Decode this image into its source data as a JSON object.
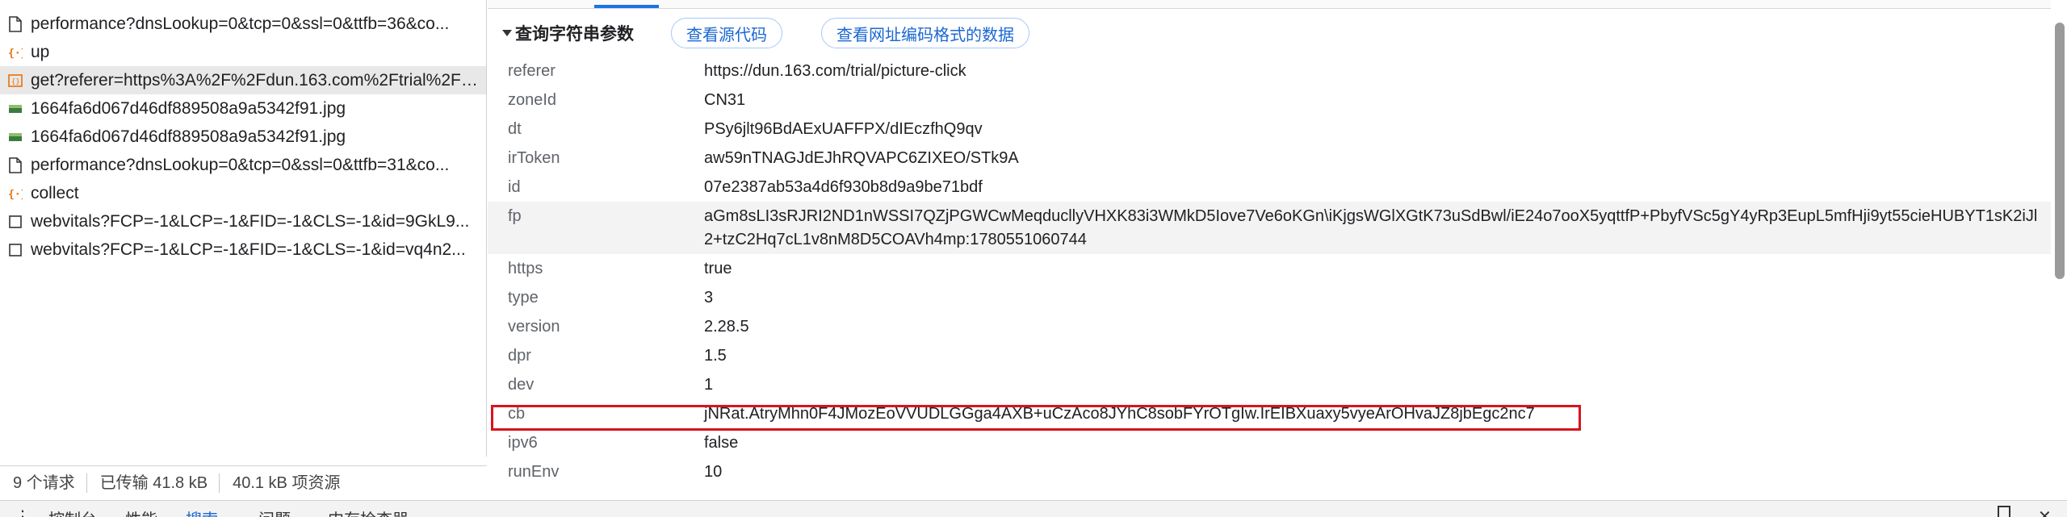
{
  "requests": [
    {
      "icon": "doc",
      "name": "performance?dnsLookup=0&tcp=0&ssl=0&ttfb=36&co..."
    },
    {
      "icon": "script",
      "name": "up"
    },
    {
      "icon": "api",
      "name": "get?referer=https%3A%2F%2Fdun.163.com%2Ftrial%2Fp...",
      "selected": true
    },
    {
      "icon": "image",
      "name": "1664fa6d067d46df889508a9a5342f91.jpg"
    },
    {
      "icon": "image",
      "name": "1664fa6d067d46df889508a9a5342f91.jpg"
    },
    {
      "icon": "doc",
      "name": "performance?dnsLookup=0&tcp=0&ssl=0&ttfb=31&co..."
    },
    {
      "icon": "script",
      "name": "collect"
    },
    {
      "icon": "checkbox",
      "name": "webvitals?FCP=-1&LCP=-1&FID=-1&CLS=-1&id=9GkL9..."
    },
    {
      "icon": "checkbox",
      "name": "webvitals?FCP=-1&LCP=-1&FID=-1&CLS=-1&id=vq4n2..."
    }
  ],
  "status_bar": {
    "requests": "9 个请求",
    "transferred": "已传输 41.8 kB",
    "resources": "40.1 kB 项资源"
  },
  "section": {
    "title": "查询字符串参数",
    "view_source": "查看源代码",
    "view_url_encoded": "查看网址编码格式的数据"
  },
  "params": [
    {
      "key": "referer",
      "value": "https://dun.163.com/trial/picture-click"
    },
    {
      "key": "zoneId",
      "value": "CN31"
    },
    {
      "key": "dt",
      "value": "PSy6jlt96BdAExUAFFPX/dIEczfhQ9qv"
    },
    {
      "key": "irToken",
      "value": "aw59nTNAGJdEJhRQVAPC6ZIXEO/STk9A"
    },
    {
      "key": "id",
      "value": "07e2387ab53a4d6f930b8d9a9be71bdf"
    },
    {
      "key": "fp",
      "value": "aGm8sLI3sRJRI2ND1nWSSI7QZjPGWCwMeqducllyVHXK83i3WMkD5Iove7Ve6oKGn\\iKjgsWGlXGtK73uSdBwl/iE24o7ooX5yqttfP+PbyfVSc5gY4yRp3EupL5mfHji9yt55cieHUBYT1sK2iJl2+tzC2Hq7cL1v8nM8D5COAVh4mp:1780551060744"
    },
    {
      "key": "https",
      "value": "true"
    },
    {
      "key": "type",
      "value": "3"
    },
    {
      "key": "version",
      "value": "2.28.5"
    },
    {
      "key": "dpr",
      "value": "1.5"
    },
    {
      "key": "dev",
      "value": "1"
    },
    {
      "key": "cb",
      "value": "jNRat.AtryMhn0F4JMozEoVVUDLGGga4AXB+uCzAco8JYhC8sobFYrOTgIw.IrEIBXuaxy5vyeArOHvaJZ8jbEgc2nc7"
    },
    {
      "key": "ipv6",
      "value": "false"
    },
    {
      "key": "runEnv",
      "value": "10"
    }
  ],
  "bottom_tabs": {
    "console": "控制台",
    "performance": "性能",
    "search": "搜索",
    "issues": "问题",
    "elements": "内存检查器"
  },
  "colors": {
    "accent": "#1a67d2",
    "highlight_border": "#d8141c",
    "selected_row": "#e8e8e8"
  }
}
